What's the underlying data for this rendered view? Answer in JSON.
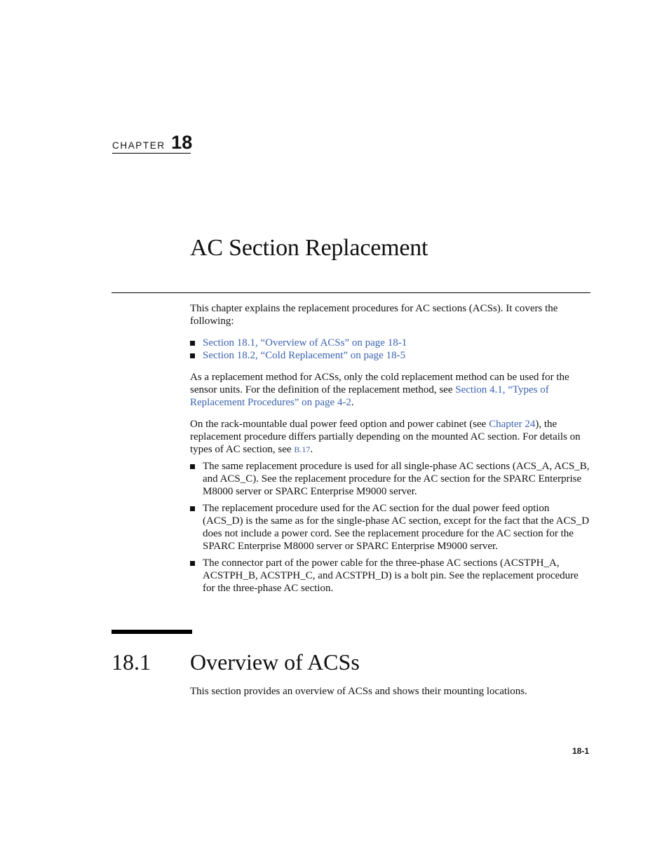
{
  "chapter": {
    "label": "CHAPTER",
    "number": "18",
    "title": "AC Section Replacement"
  },
  "intro": {
    "p1": "This chapter explains the replacement procedures for AC sections (ACSs). It covers the following:",
    "toc_links": [
      "Section 18.1, “Overview of ACSs” on page 18-1",
      "Section 18.2, “Cold Replacement” on page 18-5"
    ],
    "p2_text": "As a replacement method for ACSs, only the cold replacement method can be used for the sensor units. For the definition of the replacement method, see ",
    "p2_link": "Section 4.1, “Types of Replacement Procedures” on page 4-2",
    "p2_end": ".",
    "p3_text": "On the rack-mountable dual power feed option and power cabinet (see ",
    "p3_link": "Chapter 24",
    "p3_mid": "), the replacement procedure differs partially depending on the mounted AC section. For details on types of AC section, see ",
    "p3_link2": "B.17",
    "p3_end": ".",
    "bullets": [
      "The same replacement procedure is used for all single-phase AC sections (ACS_A, ACS_B, and ACS_C). See the replacement procedure for the AC section for the SPARC Enterprise M8000 server or SPARC Enterprise M9000 server.",
      "The replacement procedure used for the AC section for the dual power feed option (ACS_D) is the same as for the single-phase AC section, except for the fact that the ACS_D does not include a power cord. See the replacement procedure for the AC section for the SPARC Enterprise M8000 server or SPARC Enterprise M9000 server.",
      "The connector part of the power cable for the three-phase AC sections (ACSTPH_A, ACSTPH_B, ACSTPH_C, and ACSTPH_D) is a bolt pin. See the replacement procedure for the three-phase AC section."
    ]
  },
  "section": {
    "number": "18.1",
    "title": "Overview of ACSs",
    "body": "This section provides an overview of ACSs and shows their mounting locations."
  },
  "footer": {
    "page_number": "18-1"
  },
  "colors": {
    "link": "#3b63b0",
    "text": "#111111"
  }
}
